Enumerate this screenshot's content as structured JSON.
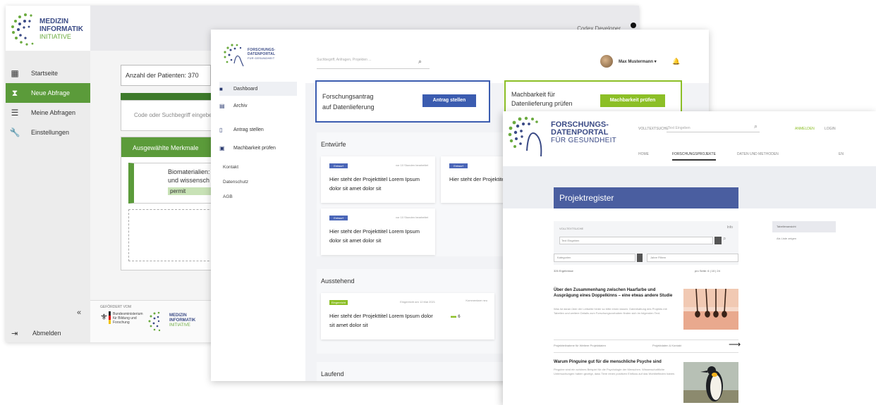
{
  "window1": {
    "logo": {
      "line1": "MEDIZIN",
      "line2": "INFORMATIK",
      "line3": "INITIATIVE"
    },
    "user_name": "Codex Developer",
    "nav": [
      {
        "label": "Startseite",
        "icon": "grid-icon",
        "active": false
      },
      {
        "label": "Neue Abfrage",
        "icon": "hourglass-icon",
        "active": true
      },
      {
        "label": "Meine Abfragen",
        "icon": "list-icon",
        "active": false
      },
      {
        "label": "Einstellungen",
        "icon": "wrench-icon",
        "active": false
      }
    ],
    "collapse_label": "«",
    "logout_label": "Abmelden",
    "patient_count": "Anzahl der Patienten: 370",
    "code_placeholder": "Code oder Suchbegriff eingeben",
    "selected_header": "Ausgewählte Merkmale",
    "selected_item_line1": "Biomaterialien:",
    "selected_item_line2": "und wissensch",
    "selected_item_value": "permit",
    "footer_funded": "GEFÖRDERT VOM",
    "footer_ministry": "Bundesministerium für Bildung und Forschung",
    "footer_logo": {
      "line1": "MEDIZIN",
      "line2": "INFORMATIK",
      "line3": "INITIATIVE"
    }
  },
  "window2": {
    "logo": {
      "line1": "FORSCHUNGS-",
      "line2": "DATENPORTAL",
      "line3": "FÜR GESUNDHEIT"
    },
    "nav": [
      {
        "label": "Dashboard",
        "icon": "folder-icon",
        "active": true
      },
      {
        "label": "Archiv",
        "icon": "archive-icon",
        "active": false
      },
      {
        "label": "Antrag stellen",
        "icon": "document-icon",
        "active": false
      },
      {
        "label": "Machbarkeit prüfen",
        "icon": "check-document-icon",
        "active": false
      }
    ],
    "links": [
      "Kontakt",
      "Datenschutz",
      "AGB"
    ],
    "search_placeholder": "Suchbegriff, Anfragen, Projekten ...",
    "user_name": "Max Mustermann",
    "antrag_text_line1": "Forschungsantrag",
    "antrag_text_line2": "auf Datenlieferung",
    "antrag_button": "Antrag stellen",
    "mach_text_line1": "Machbarkeit für",
    "mach_text_line2": "Datenlieferung prüfen",
    "mach_button": "Machbarkeit prüfen",
    "sections": [
      {
        "title": "Entwürfe"
      },
      {
        "title": "Ausstehend"
      },
      {
        "title": "Laufend"
      }
    ],
    "drafts": [
      {
        "badge": "Entwurf",
        "date": "vor 10 Stunden bearbeitet",
        "text": "Hier steht der Projekttitel Lorem Ipsum dolor sit amet dolor sit"
      },
      {
        "badge": "Entwurf",
        "date": "",
        "text": "Hier steht der Projektitel Lorem Ipsum dolor sit amet"
      },
      {
        "badge": "Entwurf",
        "date": "vor 10 Stunden bearbeitet",
        "text": "Hier steht der Projekttitel Lorem Ipsum dolor sit amet dolor sit"
      }
    ],
    "pending": [
      {
        "badge": "Eingereicht",
        "date": "Eingereicht am 12.Mai 2021",
        "text": "Hier steht der Projekttitel Lorem Ipsum dolor sit amet dolor sit",
        "comments_label": "Kommentare neu",
        "comments_count": "6"
      }
    ],
    "badge_colors": {
      "draft": "#4a66b8",
      "submitted": "#8cbf26"
    }
  },
  "window3": {
    "logo": {
      "line1": "FORSCHUNGS-",
      "line2": "DATENPORTAL",
      "line3": "FÜR GESUNDHEIT"
    },
    "search_label": "VOLLTEXTSUCHE",
    "search_placeholder": "Text Eingeben",
    "register_link": "ANMELDEN",
    "login_link": "LOGIN",
    "tabs": [
      {
        "label": "HOME",
        "active": false
      },
      {
        "label": "FORSCHUNGSPROJEKTE",
        "active": true
      },
      {
        "label": "DATEN UND METHODEN",
        "active": false
      }
    ],
    "language": "EN",
    "title": "Projektregister",
    "filter_label": "VOLLTEXTSUCHE",
    "filter_info": "Info",
    "filter_placeholder": "Text Eingeben",
    "select1": "Kategorien",
    "select2": "Jahre Filtern",
    "result_count": "326 Ergebnisse",
    "pagination": "pro Seite: 6 | 10 | 24",
    "side_box": "Tabellenansicht",
    "side_link": "Als Liste zeigen",
    "articles": [
      {
        "title": "Über den Zusammenhang zwischen Haarfarbe und Ausprägung eines Doppelkinns – eine etwas andere Studie",
        "body": "Was ist daran über der Leitseite hinter so bitte einen lassen. Datenhaltung des Projekts mit Tabellen und weitere Details zum Forschungsvorhaben finden sich im folgenden Text.",
        "meta1": "Projektteilnahme für Weitere Projektdaten",
        "meta2": "Projektdaten & Kontakt",
        "image": "hair-follicle-image"
      },
      {
        "title": "Warum Pinguine gut für die menschliche Psyche sind",
        "body": "Pinguine sind ein schönes Beispiel für die Psychologie der Menschen. Wissenschaftliche Untersuchungen haben gezeigt, dass Tiere einen positiven Einfluss auf das Wohlbefinden haben.",
        "image": "penguin-image"
      }
    ]
  }
}
